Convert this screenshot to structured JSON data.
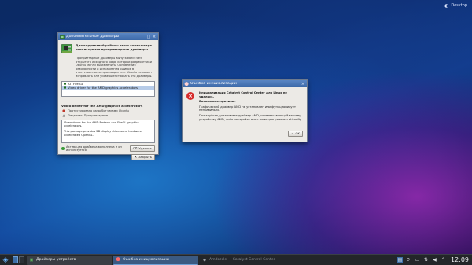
{
  "desktop": {
    "toolbox_label": "Desktop"
  },
  "drivers_window": {
    "title": "Дополнительные драйверы",
    "intro_title": "Для корректной работы этого компьютера используются проприетарные драйверы.",
    "intro_text": "Проприетарные драйверы выпускаются без открытого исходного кода, который разработчики Ubuntu могли бы изменить. Обновления безопасности и исправления ошибок в ответственности производителя. Ubuntu не может исправлять или усовершенствовать эти драйверы.",
    "driver_list": [
      {
        "label": "ATI Fire GL",
        "selected": false
      },
      {
        "label": "Video driver for the AMD graphics accelerators",
        "selected": true
      }
    ],
    "details_title": "Video driver for the AMD graphics accelerators",
    "prop_support": "Протестировано разработчиками Ubuntu",
    "prop_license": "Лицензия:    Проприетарные",
    "description_p1": "Video driver for the AMD Radeon and FireGL graphics accelerators.",
    "description_p2": "This package provides 2D display driveruand hardware accelerated OpenGL.",
    "status_text": "Активация драйвера выполнена и он используется.",
    "remove_button": "Удалить",
    "close_button": "Закрыть"
  },
  "error_dialog": {
    "title": "Ошибка инициализации",
    "message_title": "Инициализация Catalyst Control Center для Linux не удалась.",
    "message_subtitle": "Возможные причины:",
    "reason_1": "Графический драйвер AMD не установлен или функционирует неправильно.",
    "reason_2": "Пожалуйста, установите драйвер AMD, соответствующий вашему устройству AMD, либо настройте его с помощью утилиты aticonfig.",
    "ok_button": "OK"
  },
  "taskbar": {
    "tasks": [
      {
        "label": "Драйверы устройств"
      },
      {
        "label": "Ошибка инициализации"
      },
      {
        "label": "Amdcccle — Catalyst Control Center"
      }
    ],
    "clock": "12:09"
  },
  "colors": {
    "titlebar": "#3c69a8",
    "error_red": "#d62b2b",
    "selection": "#b6cbe8",
    "taskbar": "#232629"
  }
}
